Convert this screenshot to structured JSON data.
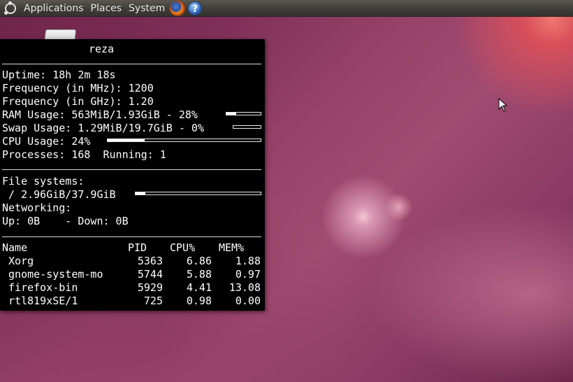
{
  "panel": {
    "menus": [
      "Applications",
      "Places",
      "System"
    ],
    "help_glyph": "?",
    "icons": [
      "ubuntu-logo-icon",
      "firefox-icon",
      "help-icon"
    ]
  },
  "conky": {
    "title": "reza",
    "uptime": "Uptime: 18h 2m 18s",
    "freq_mhz": "Frequency (in MHz): 1200",
    "freq_ghz": "Frequency (in GHz): 1.20",
    "ram": "RAM Usage: 563MiB/1.93GiB - 28%",
    "ram_fraction": 0.28,
    "swap": "Swap Usage: 1.29MiB/19.7GiB - 0%",
    "swap_fraction": 0.0,
    "cpu": "CPU Usage: 24%",
    "cpu_fraction": 0.24,
    "processes": "Processes: 168  Running: 1",
    "fs_header": "File systems:",
    "fs_root": " / 2.96GiB/37.9GiB",
    "fs_fraction": 0.08,
    "net_header": "Networking:",
    "net": "Up: 0B    - Down: 0B",
    "table_headers": [
      "Name",
      "PID",
      "CPU%",
      "MEM%"
    ],
    "rows": [
      {
        "name": " Xorg",
        "pid": "5363",
        "cpu": "6.86",
        "mem": "1.88"
      },
      {
        "name": " gnome-system-mo",
        "pid": "5744",
        "cpu": "5.88",
        "mem": "0.97"
      },
      {
        "name": " firefox-bin",
        "pid": "5929",
        "cpu": "4.41",
        "mem": "13.08"
      },
      {
        "name": " rtl819xSE/1",
        "pid": "725",
        "cpu": "0.98",
        "mem": "0.00"
      }
    ]
  }
}
